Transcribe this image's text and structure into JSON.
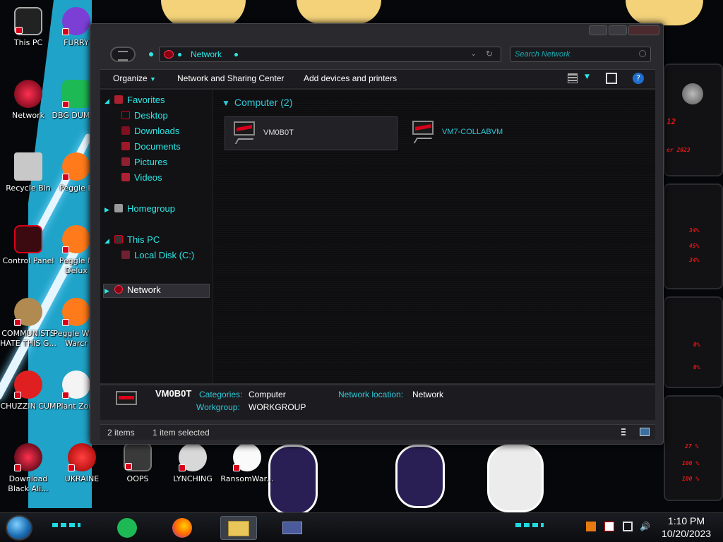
{
  "desktop": {
    "icons": [
      {
        "label": "This PC"
      },
      {
        "label": "FURRY"
      },
      {
        "label": "Network"
      },
      {
        "label": "DBG DUMBA"
      },
      {
        "label": "Recycle Bin"
      },
      {
        "label": "Peggle B"
      },
      {
        "label": "Control Panel"
      },
      {
        "label": "Peggle N Delux"
      },
      {
        "label": "COMMUNISTS HATE THIS G..."
      },
      {
        "label": "Peggle W of Warcr"
      },
      {
        "label": "CHUZZIN CUM"
      },
      {
        "label": "Plant Zom"
      },
      {
        "label": "Download Black Ali..."
      },
      {
        "label": "UKRAINE"
      },
      {
        "label": "OOPS"
      },
      {
        "label": "LYNCHING"
      },
      {
        "label": "RansomWar..."
      }
    ]
  },
  "gadget": {
    "readouts": [
      "12",
      "er 2023",
      "34%",
      "45%",
      "34%",
      "0%",
      "0%",
      "27 %",
      "100 %",
      "100 %"
    ]
  },
  "explorer": {
    "address": "Network",
    "search_placeholder": "Search Network",
    "toolbar": {
      "organize": "Organize",
      "sharing_center": "Network and Sharing Center",
      "add_devices": "Add devices and printers"
    },
    "nav": {
      "favorites": "Favorites",
      "desktop": "Desktop",
      "downloads": "Downloads",
      "documents": "Documents",
      "pictures": "Pictures",
      "videos": "Videos",
      "homegroup": "Homegroup",
      "this_pc": "This PC",
      "local_disk": "Local Disk (C:)",
      "network": "Network"
    },
    "group_header": "Computer (2)",
    "computers": [
      {
        "name": "VM0B0T"
      },
      {
        "name": "VM7-COLLABVM"
      }
    ],
    "details": {
      "name": "VM0B0T",
      "categories_label": "Categories:",
      "categories_value": "Computer",
      "workgroup_label": "Workgroup:",
      "workgroup_value": "WORKGROUP",
      "network_location_label": "Network location:",
      "network_location_value": "Network"
    },
    "status": {
      "items": "2 items",
      "selected": "1 item selected"
    }
  },
  "taskbar": {
    "time": "1:10 PM",
    "date": "10/20/2023"
  },
  "colors": {
    "accent_cyan": "#2ee6e6",
    "accent_red": "#d8001a"
  }
}
